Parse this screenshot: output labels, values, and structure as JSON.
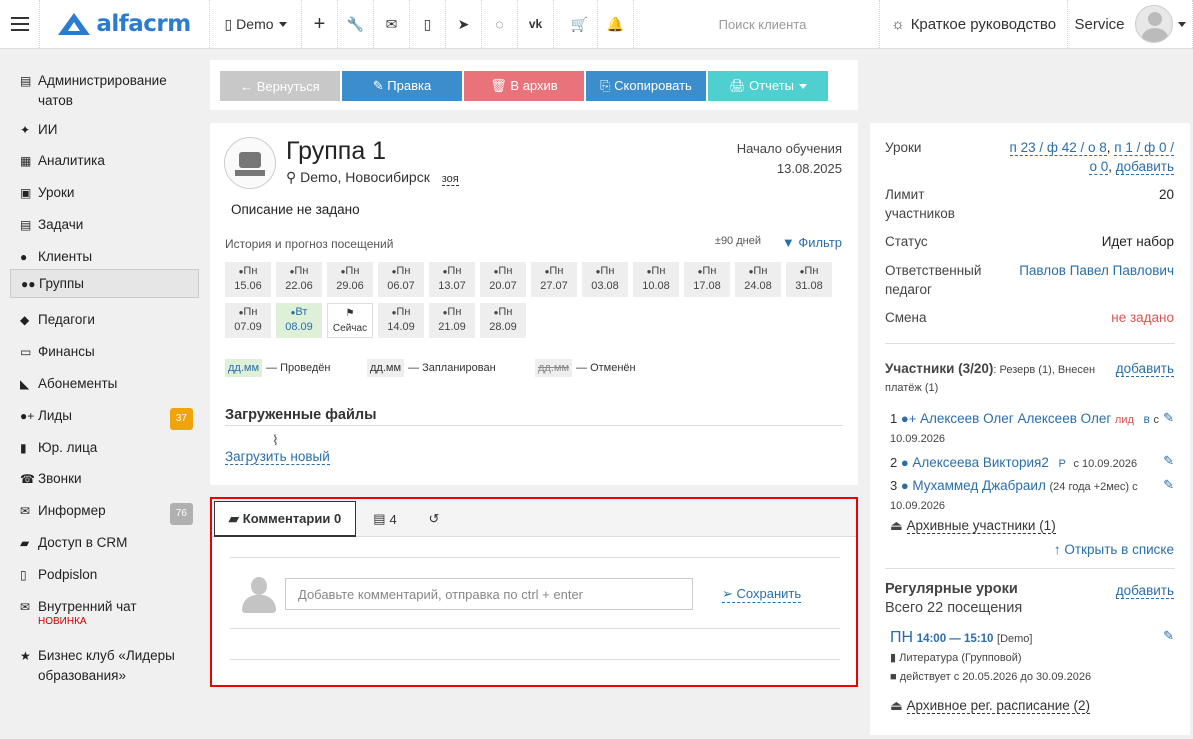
{
  "topbar": {
    "branch": "Demo",
    "search_placeholder": "Поиск клиента",
    "guide": "Краткое руководство",
    "user": "Service"
  },
  "sidebar": {
    "items": [
      {
        "label": "Администрирование чатов",
        "icon": "chat-admin-icon"
      },
      {
        "label": "ИИ",
        "icon": "sparkle-icon"
      },
      {
        "label": "Аналитика",
        "icon": "map-icon"
      },
      {
        "label": "Уроки",
        "icon": "calendar-icon"
      },
      {
        "label": "Задачи",
        "icon": "tasks-icon"
      },
      {
        "label": "Клиенты",
        "icon": "user-icon"
      },
      {
        "label": "Группы",
        "icon": "group-icon"
      },
      {
        "label": "Педагоги",
        "icon": "graduation-cap-icon"
      },
      {
        "label": "Финансы",
        "icon": "money-icon"
      },
      {
        "label": "Абонементы",
        "icon": "tag-icon"
      },
      {
        "label": "Лиды",
        "icon": "user-plus-icon",
        "badge": "37"
      },
      {
        "label": "Юр. лица",
        "icon": "briefcase-icon"
      },
      {
        "label": "Звонки",
        "icon": "phone-icon"
      },
      {
        "label": "Информер",
        "icon": "envelope-icon",
        "badge": "76"
      },
      {
        "label": "Доступ в CRM",
        "icon": "lock-icon"
      },
      {
        "label": "Podpislon",
        "icon": "document-icon"
      },
      {
        "label": "Внутренний чат",
        "icon": "envelope-icon",
        "note": "НОВИНКА"
      },
      {
        "label": "Бизнес клуб «Лидеры образования»",
        "icon": "star-icon"
      }
    ]
  },
  "toolbar": {
    "back": "← Вернуться",
    "edit": "✎ Правка",
    "archive": "🗑 В архив",
    "copy": "⎘ Скопировать",
    "reports": "🖨 Отчеты"
  },
  "group": {
    "title": "Группа 1",
    "location": "Demo, Новосибирск",
    "room": "зоя",
    "start_label": "Начало обучения",
    "start_date": "13.08.2025",
    "description": "Описание не задано",
    "history_label": "История и прогноз посещений",
    "days_range": "±90 дней",
    "filter": "Фильтр"
  },
  "attendance": [
    {
      "day": "Пн",
      "date": "15.06"
    },
    {
      "day": "Пн",
      "date": "22.06"
    },
    {
      "day": "Пн",
      "date": "29.06"
    },
    {
      "day": "Пн",
      "date": "06.07"
    },
    {
      "day": "Пн",
      "date": "13.07"
    },
    {
      "day": "Пн",
      "date": "20.07"
    },
    {
      "day": "Пн",
      "date": "27.07"
    },
    {
      "day": "Пн",
      "date": "03.08"
    },
    {
      "day": "Пн",
      "date": "10.08"
    },
    {
      "day": "Пн",
      "date": "17.08"
    },
    {
      "day": "Пн",
      "date": "24.08"
    },
    {
      "day": "Пн",
      "date": "31.08"
    },
    {
      "day": "Пн",
      "date": "07.09"
    },
    {
      "day": "Вт",
      "date": "08.09"
    },
    {
      "day": "",
      "date": "Сейчас"
    },
    {
      "day": "Пн",
      "date": "14.09"
    },
    {
      "day": "Пн",
      "date": "21.09"
    },
    {
      "day": "Пн",
      "date": "28.09"
    }
  ],
  "legend": {
    "box": "дд.мм",
    "done": "— Проведён",
    "planned": "— Запланирован",
    "cancelled": "— Отменён"
  },
  "files": {
    "heading": "Загруженные файлы",
    "upload": "Загрузить новый"
  },
  "comments": {
    "tab_comments": "Комментарии 0",
    "tab_tasks": "4",
    "placeholder": "Добавьте комментарий, отправка по ctrl + enter",
    "save": "Сохранить"
  },
  "info": {
    "lessons_label": "Уроки",
    "lessons_val1": "п 23 / ф 42 / о 8",
    "lessons_val2": "п 1 / ф 0 /",
    "lessons_val3": "о 0",
    "lessons_add": "добавить",
    "limit_label1": "Лимит",
    "limit_label2": "участников",
    "limit_val": "20",
    "status_label": "Статус",
    "status_val": "Идет набор",
    "teacher_label1": "Ответственный",
    "teacher_label2": "педагог",
    "teacher_val": "Павлов Павел Павлович",
    "shift_label": "Смена",
    "shift_val": "не задано"
  },
  "participants": {
    "heading": "Участники (3/20)",
    "sub1": ": Резерв (1), Внесен",
    "sub2": "платёж (1)",
    "add": "добавить",
    "list": [
      {
        "n": "1",
        "name": "Алексеев Олег Алексеев Олег",
        "tag": "лид",
        "tag2": "в",
        "since_pre": "с",
        "since": "10.09.2026"
      },
      {
        "n": "2",
        "name": "Алексеева Виктория2",
        "tag2": "Р",
        "since": "с 10.09.2026"
      },
      {
        "n": "3",
        "name": "Мухаммед Джабраил",
        "extra": "(24 года +2мес) с",
        "since": "10.09.2026"
      }
    ],
    "archived": "Архивные участники (1)",
    "open_list": "Открыть в списке"
  },
  "regular": {
    "heading": "Регулярные уроки",
    "add": "добавить",
    "total": "Всего 22 посещения",
    "day": "ПН",
    "time": "14:00 — 15:10",
    "branch": "[Demo]",
    "subject": "Литература (Групповой)",
    "period": "действует с 20.05.2026 до 30.09.2026",
    "archived": "Архивное рег. расписание (2)"
  },
  "colors": {
    "back": "#c8c8c8",
    "edit": "#3c8dcb",
    "archive": "#e8737a",
    "copy": "#3c8dcb",
    "reports": "#4fcfcf",
    "badge_orange": "#f0a30a",
    "badge_gray": "#b0b0b0",
    "accent": "#2a6ea8"
  }
}
